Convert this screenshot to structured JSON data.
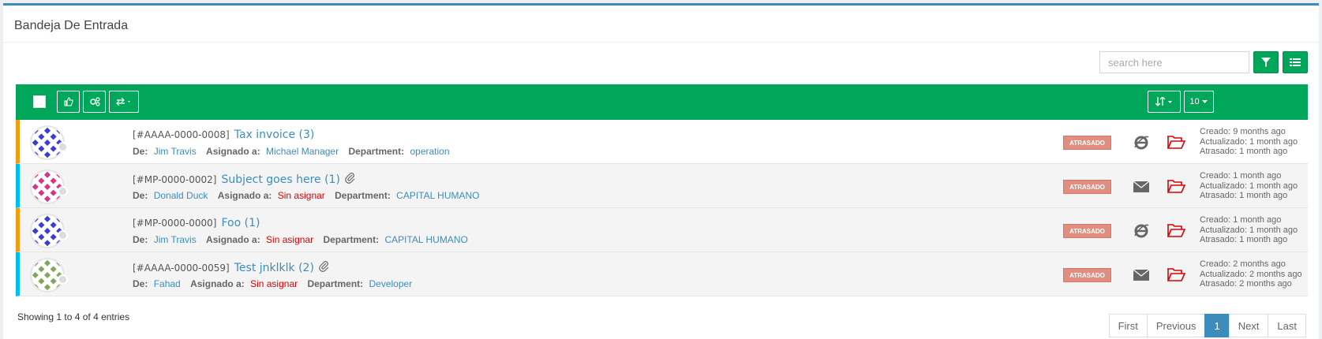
{
  "panel": {
    "title": "Bandeja De Entrada"
  },
  "search": {
    "placeholder": "search here"
  },
  "toolbar": {
    "per_page": "10"
  },
  "tickets": [
    {
      "id": "[#AAAA-0000-0008]",
      "subject": "Tax invoice (3)",
      "from_label": "De:",
      "from": "Jim Travis",
      "assigned_label": "Asignado a:",
      "assigned": "Michael Manager",
      "assigned_red": false,
      "dept_label": "Department:",
      "dept": "operation",
      "status": "ATRASADO",
      "source_icon": "ie-icon",
      "created": "Creado: 9 months ago",
      "updated": "Actualizado: 1 month ago",
      "overdue": "Atrasado: 1 month ago",
      "attachment": false,
      "priority_color": "#f39c12"
    },
    {
      "id": "[#MP-0000-0002]",
      "subject": "Subject goes here (1)",
      "from_label": "De:",
      "from": "Donald Duck",
      "assigned_label": "Asignado a:",
      "assigned": "Sin asignar",
      "assigned_red": true,
      "dept_label": "Department:",
      "dept": "CAPITAL HUMANO",
      "status": "ATRASADO",
      "source_icon": "envelope-icon",
      "created": "Creado: 1 month ago",
      "updated": "Actualizado: 1 month ago",
      "overdue": "Atrasado: 1 month ago",
      "attachment": true,
      "priority_color": "#00c0ef"
    },
    {
      "id": "[#MP-0000-0000]",
      "subject": "Foo (1)",
      "from_label": "De:",
      "from": "Jim Travis",
      "assigned_label": "Asignado a:",
      "assigned": "Sin asignar",
      "assigned_red": true,
      "dept_label": "Department:",
      "dept": "CAPITAL HUMANO",
      "status": "ATRASADO",
      "source_icon": "ie-icon",
      "created": "Creado: 1 month ago",
      "updated": "Actualizado: 1 month ago",
      "overdue": "Atrasado: 1 month ago",
      "attachment": false,
      "priority_color": "#f39c12"
    },
    {
      "id": "[#AAAA-0000-0059]",
      "subject": "Test jnklklk (2)",
      "from_label": "De:",
      "from": "Fahad",
      "assigned_label": "Asignado a:",
      "assigned": "Sin asignar",
      "assigned_red": true,
      "dept_label": "Department:",
      "dept": "Developer",
      "status": "ATRASADO",
      "source_icon": "envelope-icon",
      "created": "Creado: 2 months ago",
      "updated": "Actualizado: 2 months ago",
      "overdue": "Atrasado: 2 months ago",
      "attachment": true,
      "priority_color": "#00c0ef"
    }
  ],
  "footer": {
    "info": "Showing 1 to 4 of 4 entries"
  },
  "pagination": {
    "first": "First",
    "previous": "Previous",
    "current": "1",
    "next": "Next",
    "last": "Last"
  },
  "colors": {
    "accent": "#00a65a",
    "link": "#3c8dbc",
    "status_badge": "#e08e7f",
    "folder": "#dd0000"
  }
}
